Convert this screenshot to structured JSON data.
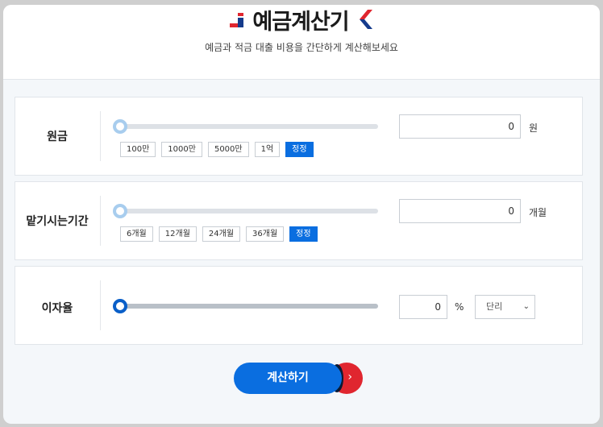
{
  "header": {
    "title": "예금계산기",
    "subtitle": "예금과 적금 대출 비용을 간단하게 계산해보세요"
  },
  "principal": {
    "label": "원금",
    "value": "0",
    "unit": "원",
    "chips": [
      "100만",
      "1000만",
      "5000만",
      "1억"
    ],
    "reset": "정정",
    "slider_level": 0
  },
  "period": {
    "label": "맡기시는기간",
    "value": "0",
    "unit": "개월",
    "chips": [
      "6개월",
      "12개월",
      "24개월",
      "36개월"
    ],
    "reset": "정정",
    "slider_level": 0
  },
  "rate": {
    "label": "이자율",
    "value": "0",
    "unit": "%",
    "select_value": "단리",
    "slider_level": 0
  },
  "action": {
    "calculate": "계산하기",
    "arrow": "›"
  },
  "colors": {
    "accent": "#0a6ee0",
    "brand_red": "#e0262f",
    "brand_navy": "#153b8c"
  },
  "icons": {
    "logo_left": "bar-chart-logo-icon",
    "logo_right": "chevron-left-logo-icon",
    "select": "chevron-down-icon"
  }
}
